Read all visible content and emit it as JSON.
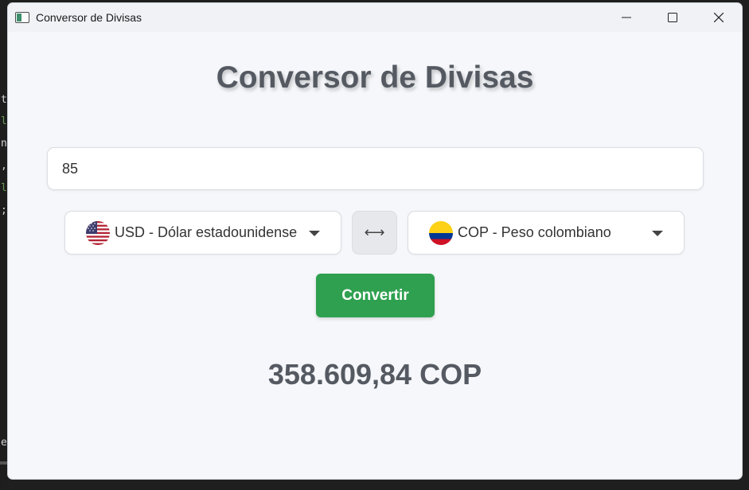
{
  "window": {
    "title": "Conversor de Divisas"
  },
  "app": {
    "heading": "Conversor de Divisas",
    "amount": {
      "value": "85",
      "placeholder": ""
    },
    "from_currency": {
      "label": "USD - Dólar estadounidense",
      "flag": "us-flag-icon"
    },
    "to_currency": {
      "label": "COP - Peso colombiano",
      "flag": "co-flag-icon"
    },
    "swap_label": "⟷",
    "convert_label": "Convertir",
    "result": "358.609,84 COP"
  },
  "colors": {
    "accent_green": "#2ea04f",
    "heading_gray": "#555a62",
    "background": "#f5f7fa"
  }
}
